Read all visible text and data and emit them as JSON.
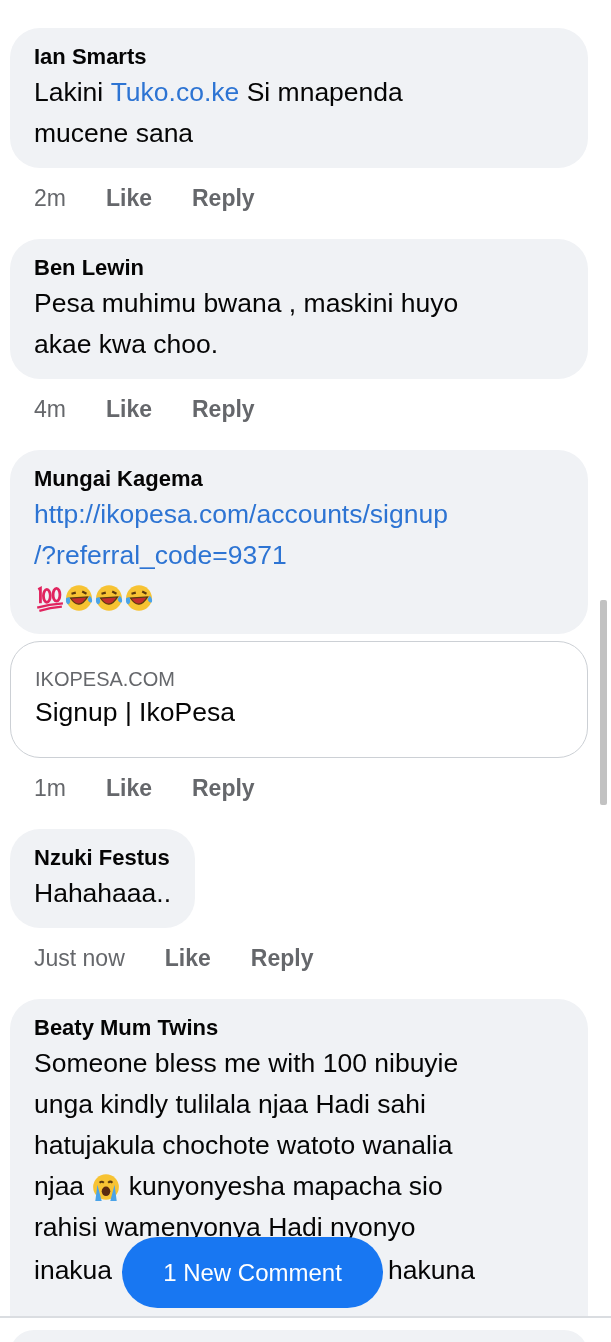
{
  "comments": [
    {
      "author": "Ian Smarts",
      "lines": [
        [
          {
            "kind": "text",
            "text": "Lakini"
          },
          {
            "kind": "link",
            "text": "Tuko.co.ke"
          },
          {
            "kind": "text",
            "text": "Si mnapenda"
          }
        ],
        [
          {
            "kind": "text",
            "text": "mucene sana"
          }
        ]
      ],
      "time": "2m",
      "actions": [
        "Like",
        "Reply"
      ]
    },
    {
      "author": "Ben Lewin",
      "lines": [
        [
          {
            "kind": "text",
            "text": "Pesa muhimu bwana , maskini huyo"
          }
        ],
        [
          {
            "kind": "text",
            "text": "akae kwa choo."
          }
        ]
      ],
      "time": "4m",
      "actions": [
        "Like",
        "Reply"
      ]
    },
    {
      "author": "Mungai Kagema",
      "lines": [
        [
          {
            "kind": "link",
            "text": "http://ikopesa.com/accounts/signup"
          }
        ],
        [
          {
            "kind": "link",
            "text": "/?referral_code=9371"
          }
        ],
        [
          {
            "kind": "hundred"
          },
          {
            "kind": "laughing"
          },
          {
            "kind": "laughing"
          },
          {
            "kind": "laughing"
          }
        ]
      ],
      "link_preview": {
        "domain": "IKOPESA.COM",
        "title": "Signup | IkoPesa"
      },
      "time": "1m",
      "actions": [
        "Like",
        "Reply"
      ]
    },
    {
      "author": "Nzuki Festus",
      "lines": [
        [
          {
            "kind": "text",
            "text": "Hahahaaa.."
          }
        ]
      ],
      "time": "Just now",
      "actions": [
        "Like",
        "Reply"
      ]
    },
    {
      "author": "Beaty Mum Twins",
      "lines": [
        [
          {
            "kind": "text",
            "text": "Someone bless me with 100 nibuyie"
          }
        ],
        [
          {
            "kind": "text",
            "text": "unga kindly tulilala njaa Hadi sahi"
          }
        ],
        [
          {
            "kind": "text",
            "text": "hatujakula chochote watoto wanalia"
          }
        ],
        [
          {
            "kind": "text",
            "text": "njaa"
          },
          {
            "kind": "crying"
          },
          {
            "kind": "text",
            "text": "kunyonyesha mapacha sio"
          }
        ],
        [
          {
            "kind": "text",
            "text": "rahisi wamenyonya Hadi nyonyo"
          }
        ],
        [
          {
            "kind": "text",
            "text": "inakua"
          },
          {
            "kind": "covered"
          },
          {
            "kind": "text",
            "text": "hakuna"
          }
        ]
      ]
    }
  ],
  "new_comment_button": "1 New Comment"
}
